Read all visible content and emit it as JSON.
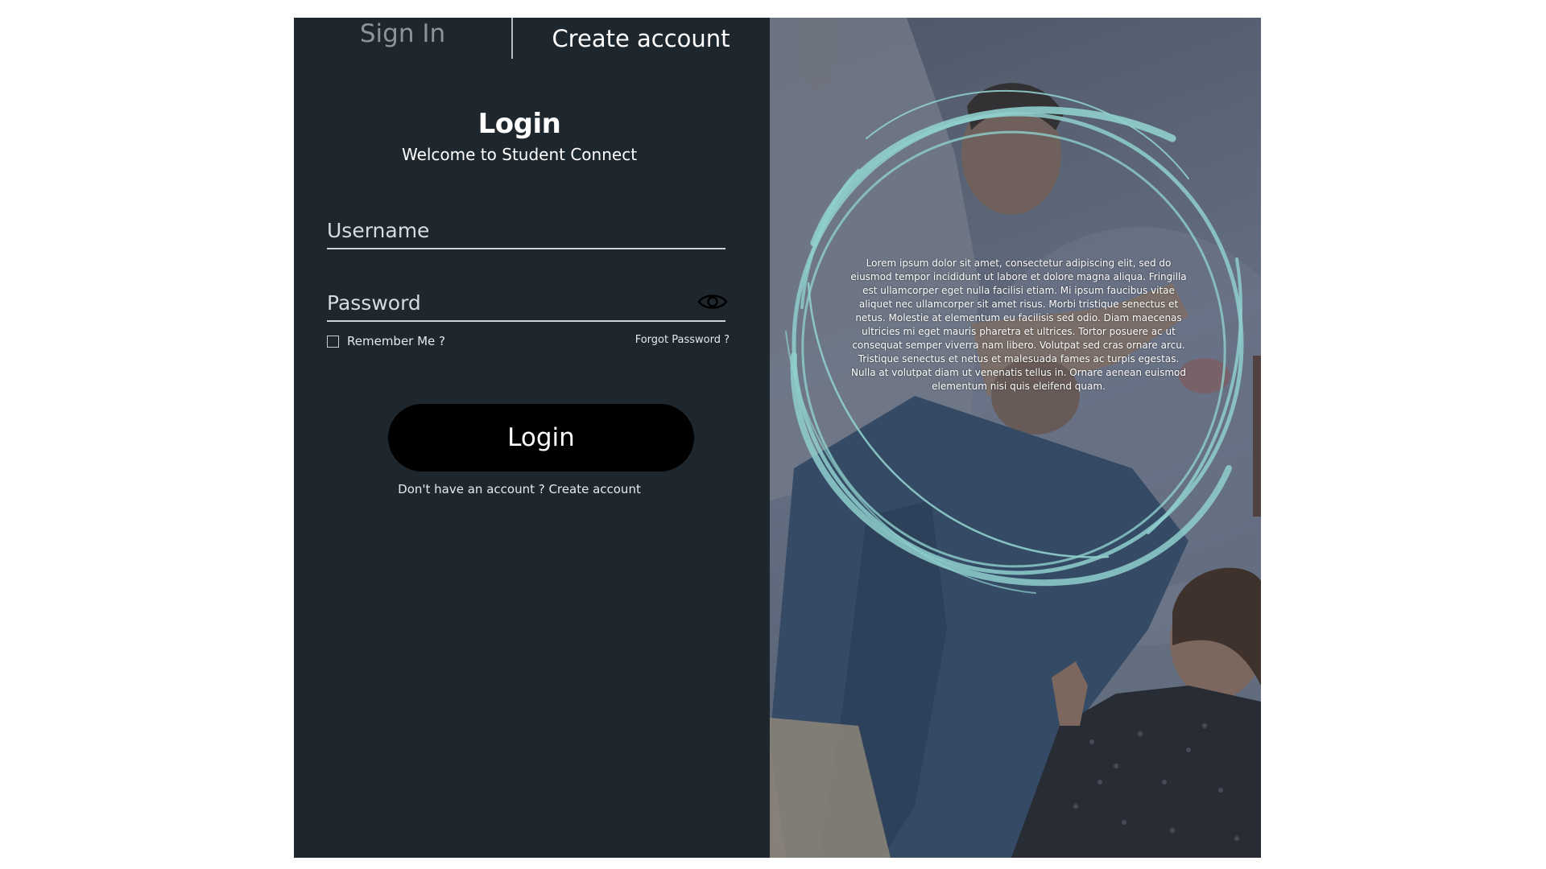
{
  "tabs": {
    "sign_in": "Sign In",
    "create_account": "Create account"
  },
  "login": {
    "title": "Login",
    "subtitle": "Welcome to Student Connect",
    "username_placeholder": "Username",
    "password_placeholder": "Password",
    "remember_me": "Remember Me ?",
    "forgot_password": "Forgot Password ?",
    "button": "Login",
    "signup_text": "Don't have an account ? Create account"
  },
  "hero": {
    "text": "Lorem ipsum dolor sit amet, consectetur adipiscing elit, sed do eiusmod tempor incididunt ut labore et dolore magna aliqua. Fringilla est ullamcorper eget nulla facilisi etiam. Mi ipsum faucibus vitae aliquet nec ullamcorper sit amet risus. Morbi tristique senectus et netus. Molestie at elementum eu facilisis sed odio. Diam maecenas ultricies mi eget mauris pharetra et ultrices. Tortor posuere ac ut consequat semper viverra nam libero. Volutpat sed cras ornare arcu. Tristique senectus et netus et malesuada fames ac turpis egestas. Nulla at volutpat diam ut venenatis tellus in. Ornare aenean euismod elementum nisi quis eleifend quam.",
    "ring_color": "#8fcfcc"
  },
  "colors": {
    "panel": "#1f272e",
    "button": "#000000"
  },
  "icons": {
    "password_toggle": "eye-icon"
  }
}
